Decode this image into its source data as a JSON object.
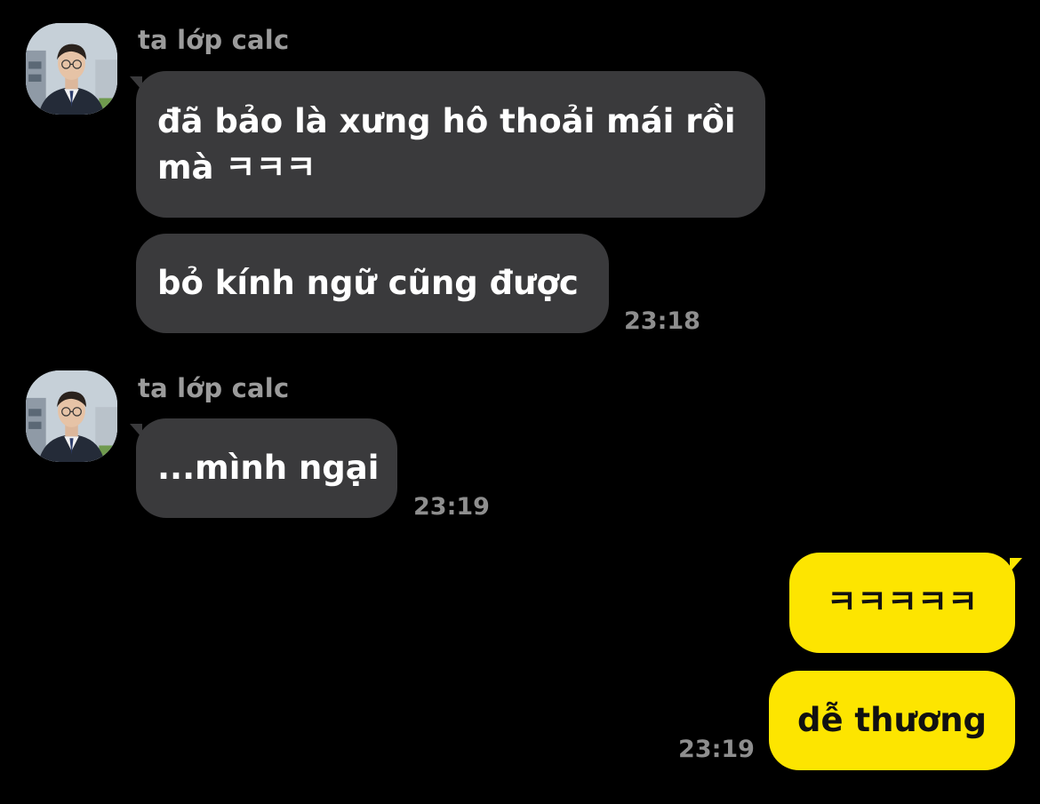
{
  "messages": [
    {
      "sender": "ta lớp calc",
      "bubbles": [
        {
          "line1": "đã bảo là xưng hô thoải mái rồi",
          "line2": "mà ㅋㅋㅋ"
        },
        {
          "text": "bỏ kính ngữ cũng được"
        }
      ],
      "time": "23:18"
    },
    {
      "sender": "ta lớp calc",
      "bubbles": [
        {
          "text": "...mình ngại"
        }
      ],
      "time": "23:19"
    },
    {
      "sender": "me",
      "bubbles": [
        {
          "text": "ㅋㅋㅋㅋㅋ"
        },
        {
          "text": "dễ thương"
        }
      ],
      "time": "23:19"
    }
  ],
  "colors": {
    "background": "#000000",
    "incoming_bubble": "#3a3a3c",
    "outgoing_bubble": "#fde500",
    "name_text": "#9b9b9b",
    "time_text": "#8e8e8e"
  }
}
